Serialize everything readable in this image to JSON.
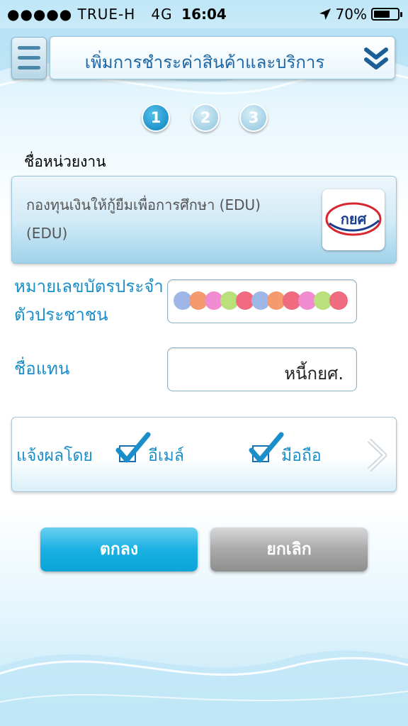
{
  "status_bar": {
    "signal": "●●●●●",
    "carrier": "TRUE-H",
    "network": "4G",
    "time": "16:04",
    "battery_text": "70%",
    "battery_level": 0.7,
    "location_icon": "location-arrow-icon"
  },
  "header": {
    "title": "เพิ่มการชำระค่าสินค้าและบริการ",
    "menu_icon": "hamburger-menu-icon",
    "expand_icon": "double-chevron-down-icon"
  },
  "steps": [
    {
      "label": "1",
      "active": true
    },
    {
      "label": "2",
      "active": false
    },
    {
      "label": "3",
      "active": false
    }
  ],
  "agency": {
    "label": "ชื่อหน่วยงาน",
    "name_line1": "กองทุนเงินให้กู้ยืมเพื่อการศึกษา (EDU)",
    "name_line2": "(EDU)",
    "logo_text": "กยศ"
  },
  "citizen_id": {
    "label_line1": "หมายเลขบัตรประจำ",
    "label_line2": "ตัวประชาชน",
    "masked": true
  },
  "alias": {
    "label": "ชื่อแทน",
    "value": "หนี้กยศ."
  },
  "notify": {
    "label": "แจ้งผลโดย",
    "options": [
      {
        "label": "อีเมล์",
        "checked": true
      },
      {
        "label": "มือถือ",
        "checked": true
      }
    ],
    "next_icon": "chevron-right-icon"
  },
  "buttons": {
    "ok": "ตกลง",
    "cancel": "ยกเลิก"
  },
  "colors": {
    "accent": "#1a8ec8",
    "title": "#1b66a6",
    "ok_button": "#1ab1e2",
    "cancel_button": "#a9a9a9"
  }
}
